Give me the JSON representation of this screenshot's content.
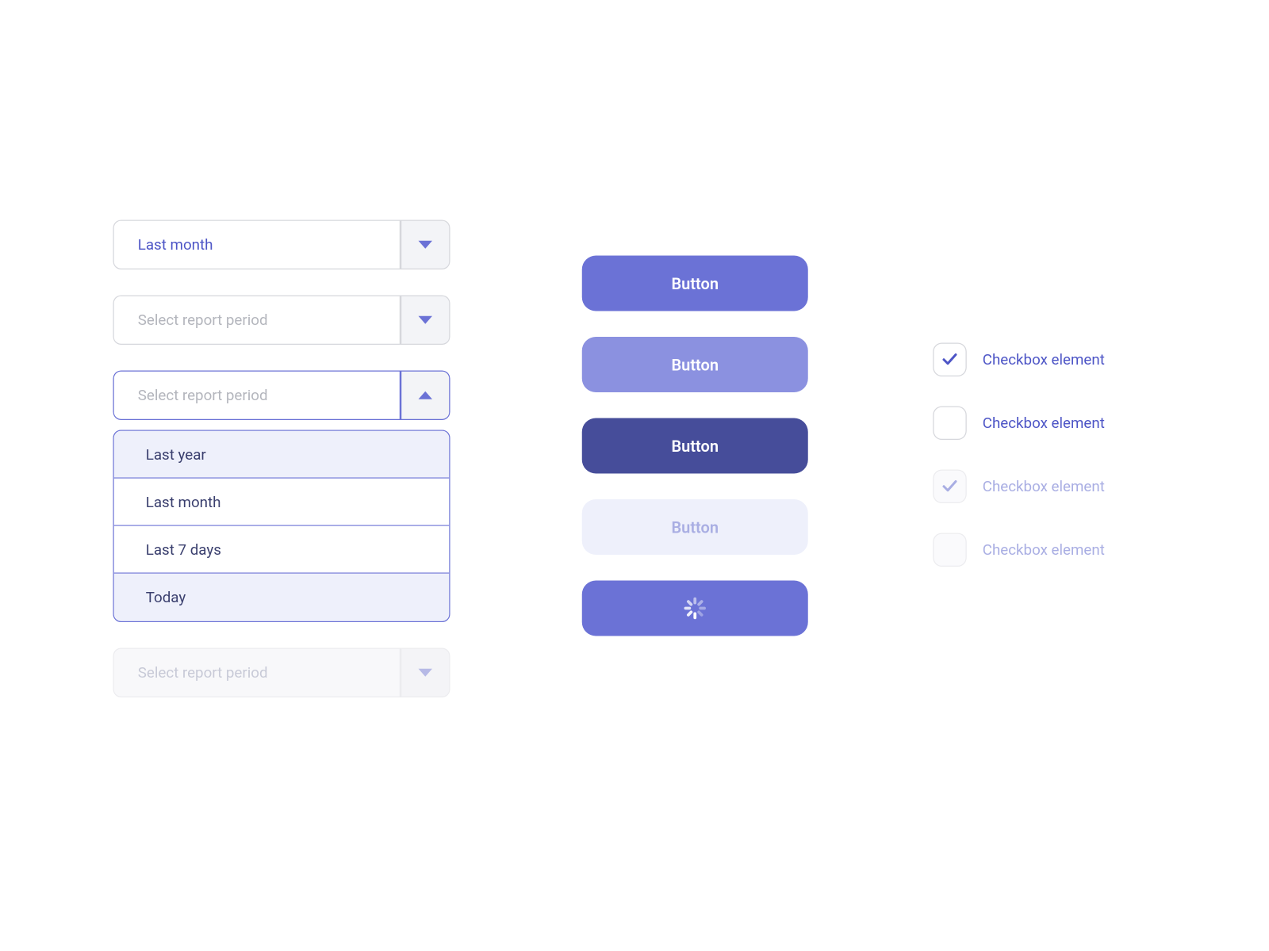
{
  "dropdowns": {
    "selected_value": "Last month",
    "placeholder": "Select report period",
    "options": [
      "Last year",
      "Last month",
      "Last 7 days",
      "Today"
    ]
  },
  "buttons": {
    "label": "Button"
  },
  "checkboxes": {
    "label": "Checkbox element"
  },
  "colors": {
    "primary": "#6b72d6",
    "primary_hover": "#8b91e0",
    "primary_active": "#464d9a",
    "disabled_bg": "#eef0fb",
    "text_muted": "#a9aee3"
  }
}
